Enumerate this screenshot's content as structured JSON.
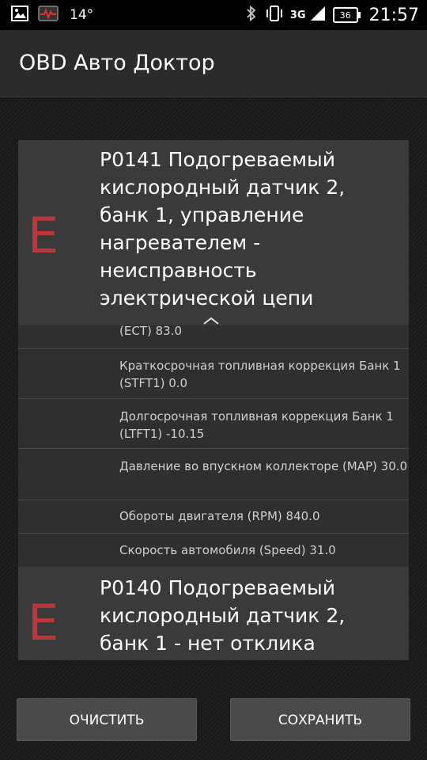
{
  "status_bar": {
    "temperature": "14°",
    "network": "3G",
    "battery": "36",
    "time": "21:57",
    "icons": [
      "image-icon",
      "obd-monitor-icon",
      "bluetooth-icon",
      "vibrate-icon",
      "signal-icon",
      "battery-icon"
    ]
  },
  "app": {
    "title": "OBD Авто Доктор"
  },
  "dtc_cards": [
    {
      "severity_letter": "E",
      "text": "P0141  Подогреваемый кислородный датчик 2, банк 1, управление нагревателем - неисправность электрической цепи"
    },
    {
      "severity_letter": "E",
      "text": "P0140  Подогреваемый кислородный датчик 2, банк 1 - нет отклика"
    }
  ],
  "freeze_frame_params": [
    {
      "label": "(ECT) 83.0"
    },
    {
      "label": "Краткосрочная топливная коррекция Банк 1 (STFT1) 0.0"
    },
    {
      "label": "Долгосрочная топливная коррекция Банк 1 (LTFT1) -10.15"
    },
    {
      "label": "Давление во впускном коллекторе (MAP) 30.0"
    },
    {
      "label": "Обороты двигателя (RPM) 840.0"
    },
    {
      "label": "Скорость автомобиля (Speed) 31.0"
    }
  ],
  "buttons": {
    "clear": "ОЧИСТИТЬ",
    "save": "СОХРАНИТЬ"
  },
  "colors": {
    "severity_error": "#b8383a",
    "card_bg": "#3a3a3a",
    "list_bg": "#2f2f2f"
  }
}
